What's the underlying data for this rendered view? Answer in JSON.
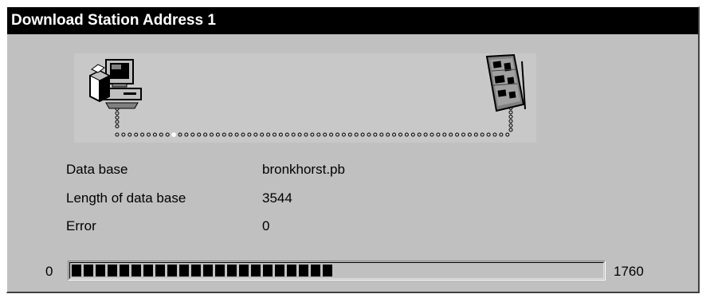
{
  "window": {
    "title": "Download Station Address 1"
  },
  "diagram": {
    "source_icon": "computer-with-box-icon",
    "target_icon": "circuit-board-icon",
    "connection": "dotted-path",
    "transfer_progress": 0.2
  },
  "fields": {
    "database_label": "Data base",
    "database_value": "bronkhorst.pb",
    "length_label": "Length of data base",
    "length_value": "3544",
    "error_label": "Error",
    "error_value": "0"
  },
  "progress": {
    "min": "0",
    "max": "1760",
    "fraction": 0.5,
    "color": "#000000"
  },
  "colors": {
    "titlebar": "#000000",
    "title_text": "#ffffff",
    "window_bg": "#c0c0c0"
  }
}
